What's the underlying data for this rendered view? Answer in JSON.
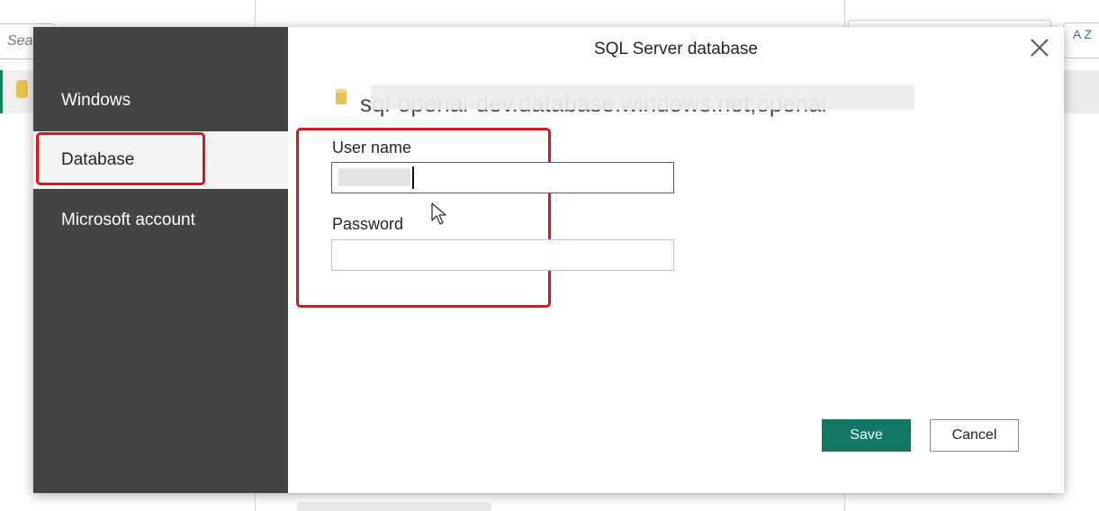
{
  "background": {
    "search_placeholder": "Sea",
    "sort_icon_text": "A Z"
  },
  "dialog": {
    "title": "SQL Server database",
    "server": "sql-openai-dev.database.windows.net;openai",
    "nav": {
      "windows": "Windows",
      "database": "Database",
      "microsoft_account": "Microsoft account",
      "selected": "Database"
    },
    "fields": {
      "username_label": "User name",
      "username_value": "",
      "password_label": "Password",
      "password_value": ""
    },
    "buttons": {
      "save": "Save",
      "cancel": "Cancel"
    },
    "icons": {
      "close": "close-icon",
      "database": "database-icon",
      "cursor": "mouse-pointer-icon"
    }
  },
  "colors": {
    "nav_background": "#444444",
    "primary_button": "#117865",
    "highlight": "#e0141e",
    "database_icon": "#e8c14f"
  }
}
